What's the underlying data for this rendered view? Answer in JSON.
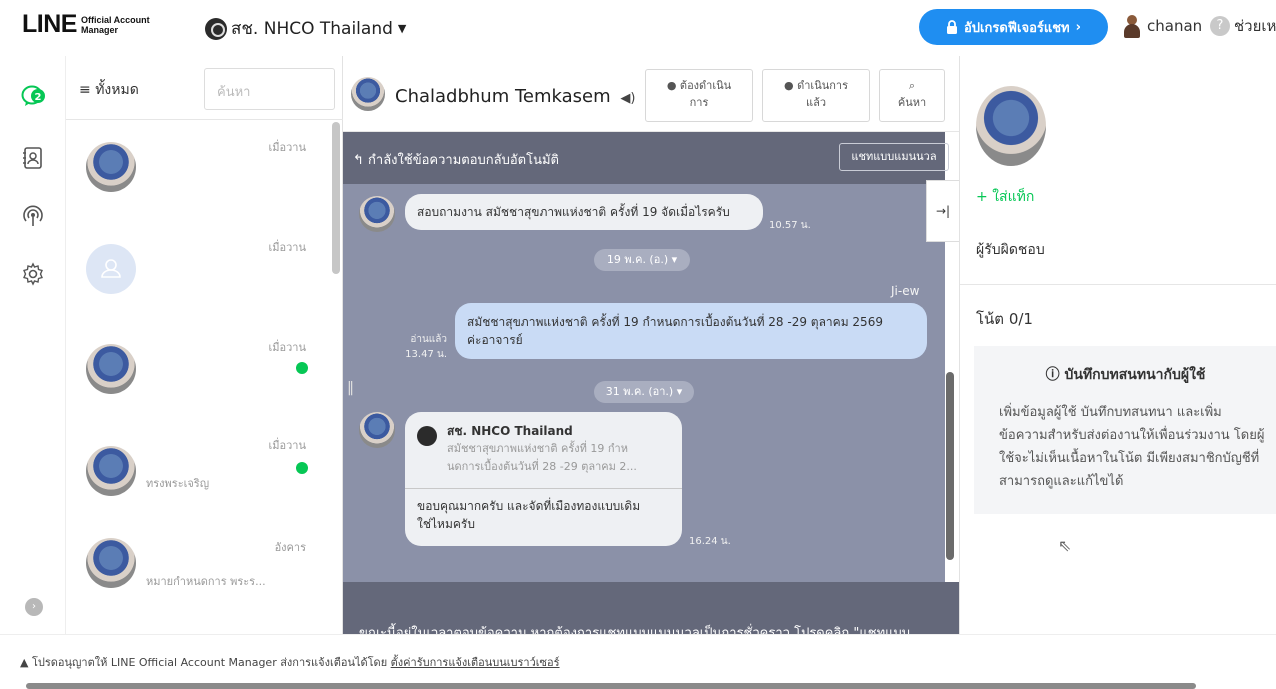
{
  "header": {
    "logo_main": "LINE",
    "logo_sub_line1": "Official Account",
    "logo_sub_line2": "Manager",
    "account_name": "สช. NHCO Thailand",
    "upgrade_label": "อัปเกรดฟีเจอร์แชท",
    "username": "chanan",
    "help_label": "ช่วยเห"
  },
  "rail": {
    "chat_badge": "2"
  },
  "chat_list": {
    "filter_label": "ทั้งหมด",
    "search_placeholder": "ค้นหา",
    "items": [
      {
        "time": "เมื่อวาน",
        "preview": "",
        "online": false
      },
      {
        "time": "เมื่อวาน",
        "preview": "",
        "online": false
      },
      {
        "time": "เมื่อวาน",
        "preview": "",
        "online": true
      },
      {
        "time": "เมื่อวาน",
        "preview": "ทรงพระเจริญ",
        "online": true
      },
      {
        "time": "อังคาร",
        "preview": "หมายกำหนดการ พระร...",
        "online": false
      }
    ]
  },
  "chat": {
    "contact_name": "Chaladbhum Temkasem",
    "btn_todo_line1": "ต้องดำเนิน",
    "btn_todo_line2": "การ",
    "btn_done_line1": "ดำเนินการ",
    "btn_done_line2": "แล้ว",
    "btn_search": "ค้นหา",
    "autoreply_text": "กำลังใช้ข้อความตอบกลับอัตโนมัติ",
    "manual_chat_label": "แชทแบบแมนนวล",
    "messages": [
      {
        "text": "สอบถามงาน สมัชชาสุขภาพแห่งชาติ ครั้งที่ 19 จัดเมื่อไรครับ",
        "time": "10.57 น."
      },
      {
        "date_label": "19 พ.ค. (อ.)"
      },
      {
        "sender": "Ji-ew",
        "read_label": "อ่านแล้ว",
        "time": "13.47 น.",
        "text_line1": "สมัชชาสุขภาพแห่งชาติ ครั้งที่ 19  กำหนดการเบื้องต้นวันที่ 28 -29 ตุลาคม 2569",
        "text_line2": "ค่ะอาจารย์"
      },
      {
        "date_label": "31 พ.ค. (อา.)"
      },
      {
        "quote_sender": "สช. NHCO Thailand",
        "quote_line1": "สมัชชาสุขภาพแห่งชาติ ครั้งที่ 19  กำห",
        "quote_line2": "นดการเบื้องต้นวันที่ 28 -29 ตุลาคม 2...",
        "reply_line1": "ขอบคุณมากครับ และจัดที่เมืองทองแบบเดิม",
        "reply_line2": "ใช่ไหมครับ",
        "time": "16.24 น."
      }
    ],
    "notice_text": "ขณะนี้อยู่ในเวลาตอบข้อความ หากต้องการแชทแบบแมนนวลเป็นการชั่วคราว โปรดคลิก \"แชทแบบ"
  },
  "right_panel": {
    "add_tag_label": "ใส่แท็ก",
    "assignee_label": "ผู้รับผิดชอบ",
    "notes_label": "โน้ต 0/1",
    "notes_heading": "บันทึกบทสนทนากับผู้ใช้",
    "notes_body": "เพิ่มข้อมูลผู้ใช้ บันทึกบทสนทนา และเพิ่มข้อความสำหรับส่งต่องานให้เพื่อนร่วมงาน โดยผู้ใช้จะไม่เห็นเนื้อหาในโน้ต มีเพียงสมาชิกบัญชีที่สามารถดูและแก้ไขได้"
  },
  "bottom": {
    "text": "โปรดอนุญาตให้ LINE Official Account Manager ส่งการแจ้งเตือนได้โดย",
    "link": "ตั้งค่ารับการแจ้งเตือนบนเบราว์เซอร์"
  },
  "colors": {
    "line_green": "#06c755",
    "upgrade_blue": "#1f8ef1",
    "chat_bg": "#8b91a8",
    "bar_dark": "#64687a"
  }
}
